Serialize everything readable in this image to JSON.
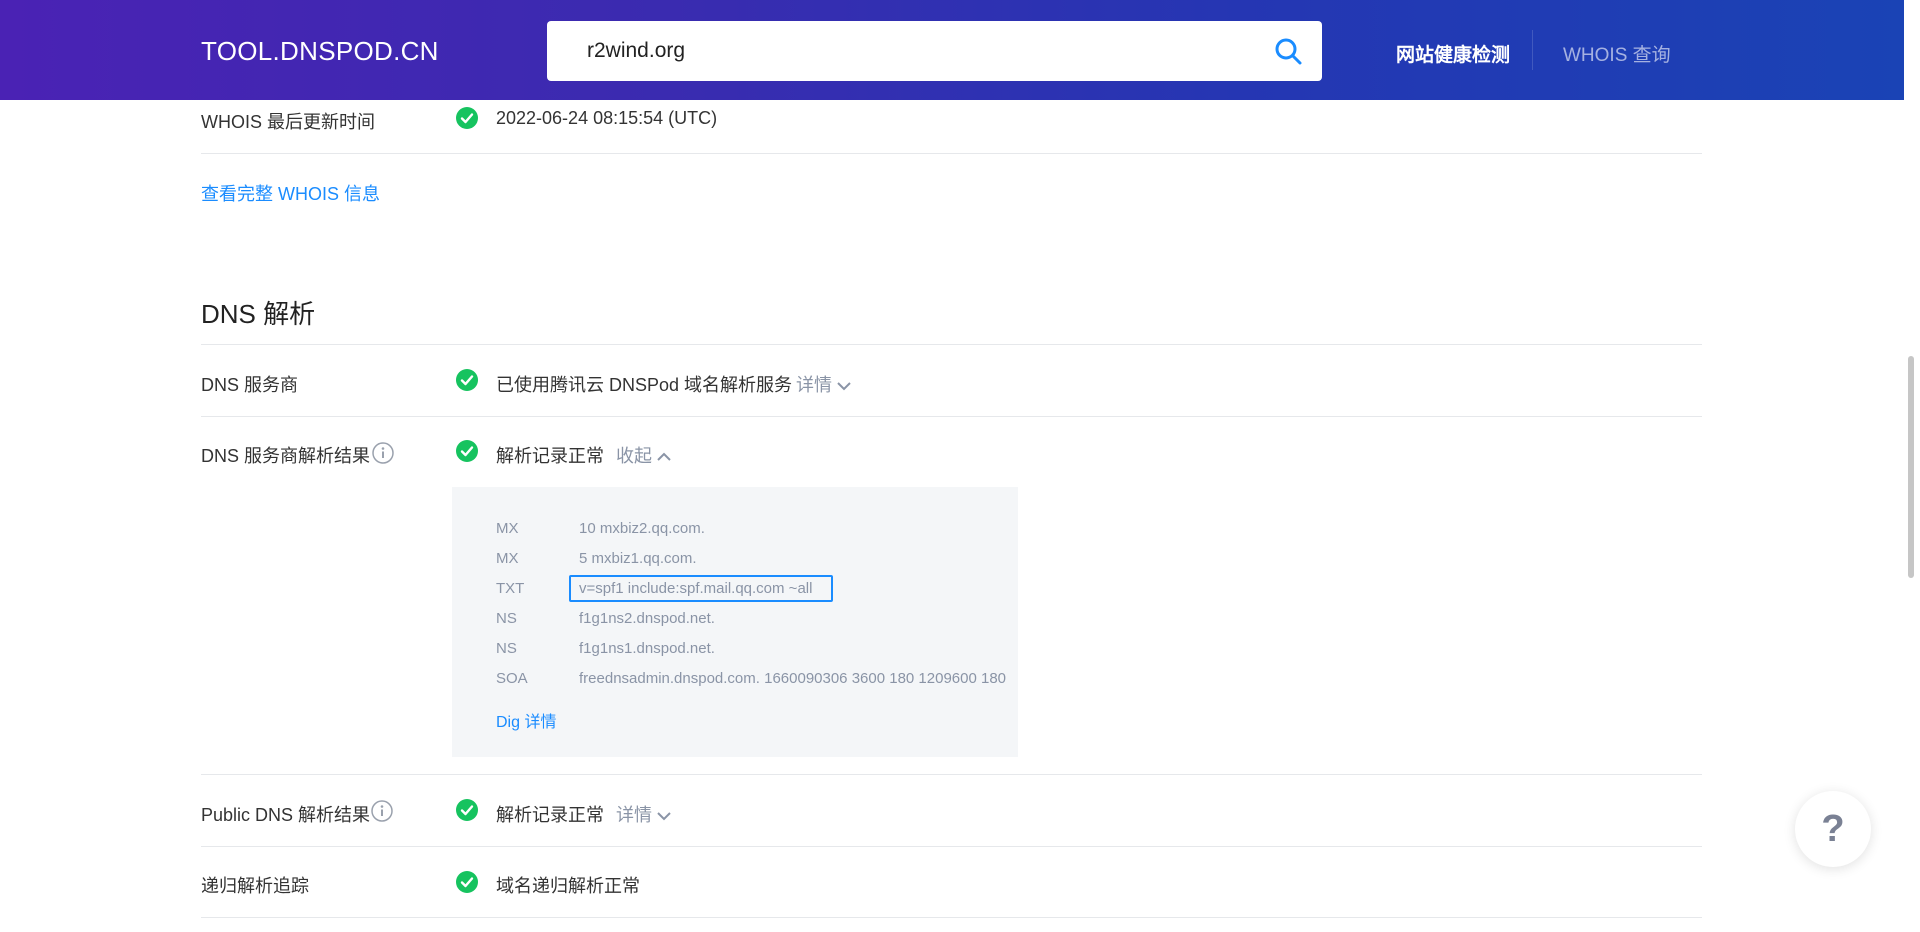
{
  "header": {
    "logo": "TOOL.DNSPOD.CN",
    "search_value": "r2wind.org",
    "nav_health": "网站健康检测",
    "nav_whois": "WHOIS 查询"
  },
  "whois": {
    "update_label": "WHOIS 最后更新时间",
    "update_value": "2022-06-24 08:15:54 (UTC)",
    "full_link": "查看完整 WHOIS 信息"
  },
  "dns": {
    "section_title": "DNS 解析",
    "provider_label": "DNS 服务商",
    "provider_value": "已使用腾讯云 DNSPod 域名解析服务",
    "provider_toggle": "详情",
    "result_label": "DNS 服务商解析结果",
    "result_value": "解析记录正常",
    "result_toggle": "收起",
    "records": [
      {
        "type": "MX",
        "value": "10 mxbiz2.qq.com."
      },
      {
        "type": "MX",
        "value": "5 mxbiz1.qq.com."
      },
      {
        "type": "TXT",
        "value": "v=spf1 include:spf.mail.qq.com ~all"
      },
      {
        "type": "NS",
        "value": "f1g1ns2.dnspod.net."
      },
      {
        "type": "NS",
        "value": "f1g1ns1.dnspod.net."
      },
      {
        "type": "SOA",
        "value": "freednsadmin.dnspod.com. 1660090306 3600 180 1209600 180"
      }
    ],
    "dig_link": "Dig 详情",
    "public_label": "Public DNS 解析结果",
    "public_value": "解析记录正常",
    "public_toggle": "详情",
    "recursive_label": "递归解析追踪",
    "recursive_value": "域名递归解析正常"
  },
  "help": {
    "label": "?"
  },
  "colors": {
    "check": "#16c35f",
    "link": "#1a8cff",
    "accent_start": "#4a22b4",
    "accent_end": "#1a43b5"
  }
}
